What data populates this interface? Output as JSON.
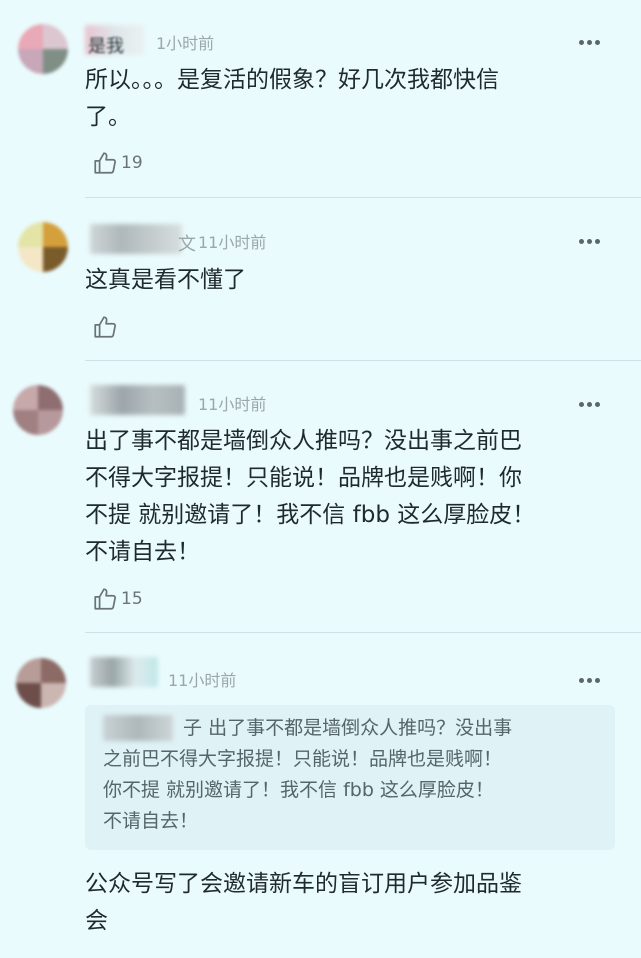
{
  "comments": [
    {
      "name_tail": "是我",
      "time": "1小时前",
      "text": "所以。。。是复活的假象？好几次我都快信\n了。",
      "likes": "19"
    },
    {
      "name_tail": "文",
      "time": "11小时前",
      "text": "这真是看不懂了",
      "likes": ""
    },
    {
      "name_tail": "",
      "time": "11小时前",
      "text": "出了事不都是墙倒众人推吗？没出事之前巴\n不得大字报提！只能说！品牌也是贱啊！你\n不提 就别邀请了！我不信 fbb 这么厚脸皮！\n不请自去！",
      "likes": "15"
    },
    {
      "name_tail": "",
      "time": "11小时前",
      "quote_name_tail": "子",
      "quote_text": "出了事不都是墙倒众人推吗？没出事\n之前巴不得大字报提！只能说！品牌也是贱啊！\n你不提 就别邀请了！我不信 fbb 这么厚脸皮！\n不请自去！",
      "text": "公众号写了会邀请新车的盲订用户参加品鉴\n会"
    }
  ],
  "colors": {
    "background": "#eafbfd",
    "text": "#1f2a2e",
    "meta": "#9aa7ab",
    "quote_bg": "#dff2f6"
  },
  "icons": {
    "like": "thumb-up-icon",
    "more": "more-dots-icon"
  }
}
